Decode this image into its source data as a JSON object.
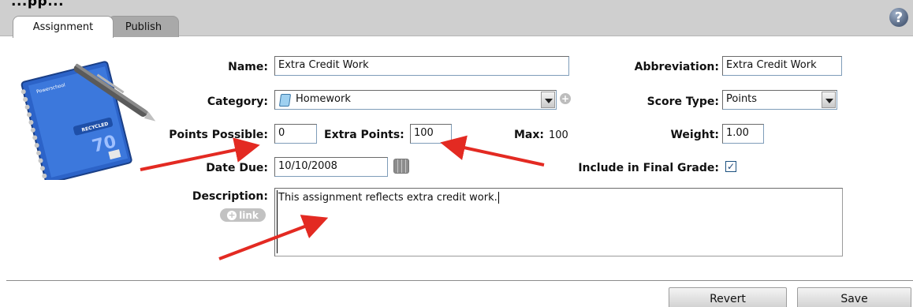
{
  "window": {
    "partial_title": "...pp..."
  },
  "tabs": [
    {
      "label": "Assignment",
      "active": true
    },
    {
      "label": "Publish",
      "active": false
    }
  ],
  "help_icon_label": "?",
  "notebook_image": {
    "brand_text": "Powerschool",
    "recycled_text": "RECYCLED",
    "number_text": "70"
  },
  "form": {
    "name_label": "Name:",
    "name_value": "Extra Credit Work",
    "abbreviation_label": "Abbreviation:",
    "abbreviation_value": "Extra Credit Work",
    "category_label": "Category:",
    "category_value": "Homework",
    "category_icon": "folder-icon",
    "score_type_label": "Score Type:",
    "score_type_value": "Points",
    "points_possible_label": "Points Possible:",
    "points_possible_value": "0",
    "extra_points_label": "Extra Points:",
    "extra_points_value": "100",
    "max_label": "Max:",
    "max_value": "100",
    "weight_label": "Weight:",
    "weight_value": "1.00",
    "date_due_label": "Date Due:",
    "date_due_value": "10/10/2008",
    "include_final_label": "Include in Final Grade:",
    "include_final_checked": true,
    "description_label": "Description:",
    "description_value": "This assignment reflects extra credit work.",
    "link_button_label": "link"
  },
  "buttons": {
    "revert_label": "Revert",
    "save_label": "Save"
  },
  "colors": {
    "topbar": "#cfcfcf",
    "arrow": "#e32a22",
    "tab_inactive": "#a9a9a9"
  }
}
